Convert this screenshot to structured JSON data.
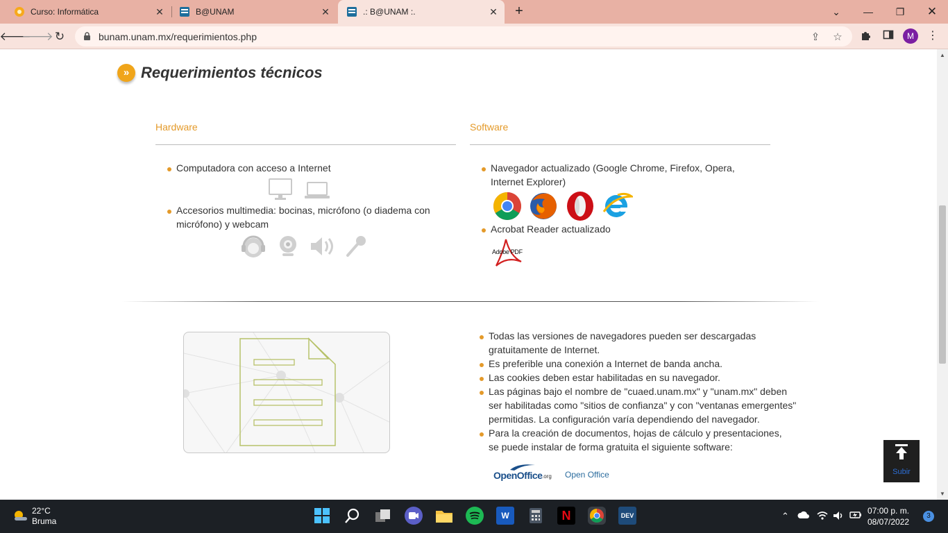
{
  "browser": {
    "tabs": [
      {
        "title": "Curso: Informática",
        "favicon": "moodle-favicon"
      },
      {
        "title": "B@UNAM",
        "favicon": "bunam-favicon"
      },
      {
        "title": ".: B@UNAM :.",
        "favicon": "bunam-favicon"
      }
    ],
    "active_tab": 2,
    "url": "bunam.unam.mx/requerimientos.php",
    "profile_initial": "M"
  },
  "page": {
    "title": "Requerimientos técnicos",
    "hardware": {
      "heading": "Hardware",
      "items": [
        "Computadora con acceso a Internet",
        "Accesorios multimedia: bocinas, micrófono (o diadema con micrófono) y webcam"
      ]
    },
    "software": {
      "heading": "Software",
      "items": [
        "Navegador actualizado (Google Chrome, Firefox, Opera, Internet Explorer)",
        "Acrobat Reader actualizado"
      ],
      "adobe_logo_text": "Adobe PDF"
    },
    "notes": [
      "Todas las versiones de navegadores pueden ser descargadas gratuitamente de Internet.",
      "Es preferible una conexión a Internet de banda ancha.",
      "Las cookies deben estar habilitadas en su navegador.",
      "Las páginas bajo el nombre de \"cuaed.unam.mx\" y \"unam.mx\" deben ser habilitadas como \"sitios de confianza\" y con \"ventanas emergentes\" permitidas. La configuración varía dependiendo del navegador.",
      "Para la creación de documentos, hojas de cálculo y presentaciones, se puede instalar de forma gratuita el siguiente software:"
    ],
    "openoffice": {
      "logo_text": "OpenOffice",
      "logo_suffix": ".org",
      "link": "Open Office"
    },
    "scroll_top": {
      "label": "Subir"
    }
  },
  "taskbar": {
    "weather_temp": "22°C",
    "weather_desc": "Bruma",
    "time": "07:00 p. m.",
    "date": "08/07/2022",
    "notifications": "3"
  },
  "colors": {
    "accent": "#e49a2a",
    "tabbar": "#e8b1a4",
    "toolbar": "#f8e3dd"
  }
}
